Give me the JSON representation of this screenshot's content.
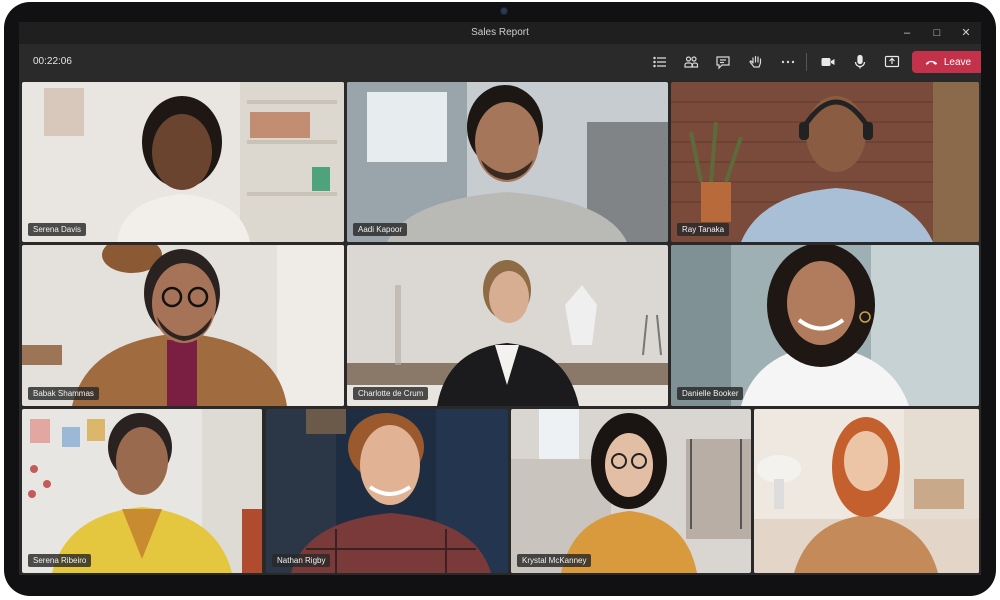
{
  "window": {
    "title": "Sales Report"
  },
  "meeting": {
    "timer": "00:22:06",
    "leave_label": "Leave"
  },
  "toolbar_icons": [
    "participants-list-icon",
    "people-icon",
    "chat-icon",
    "raise-hand-icon",
    "more-options-icon",
    "camera-icon",
    "microphone-icon",
    "share-screen-icon"
  ],
  "participants": [
    {
      "name": "Serena Davis"
    },
    {
      "name": "Aadi Kapoor"
    },
    {
      "name": "Ray Tanaka"
    },
    {
      "name": "Babak Shammas"
    },
    {
      "name": "Charlotte de Crum"
    },
    {
      "name": "Danielle Booker"
    },
    {
      "name": "Serena Ribeiro"
    },
    {
      "name": "Nathan Rigby"
    },
    {
      "name": "Krystal McKanney"
    },
    {
      "name": ""
    }
  ],
  "colors": {
    "leave": "#c4314b",
    "toolbar": "#2a2a2a",
    "titlebar": "#1f1f1f"
  }
}
